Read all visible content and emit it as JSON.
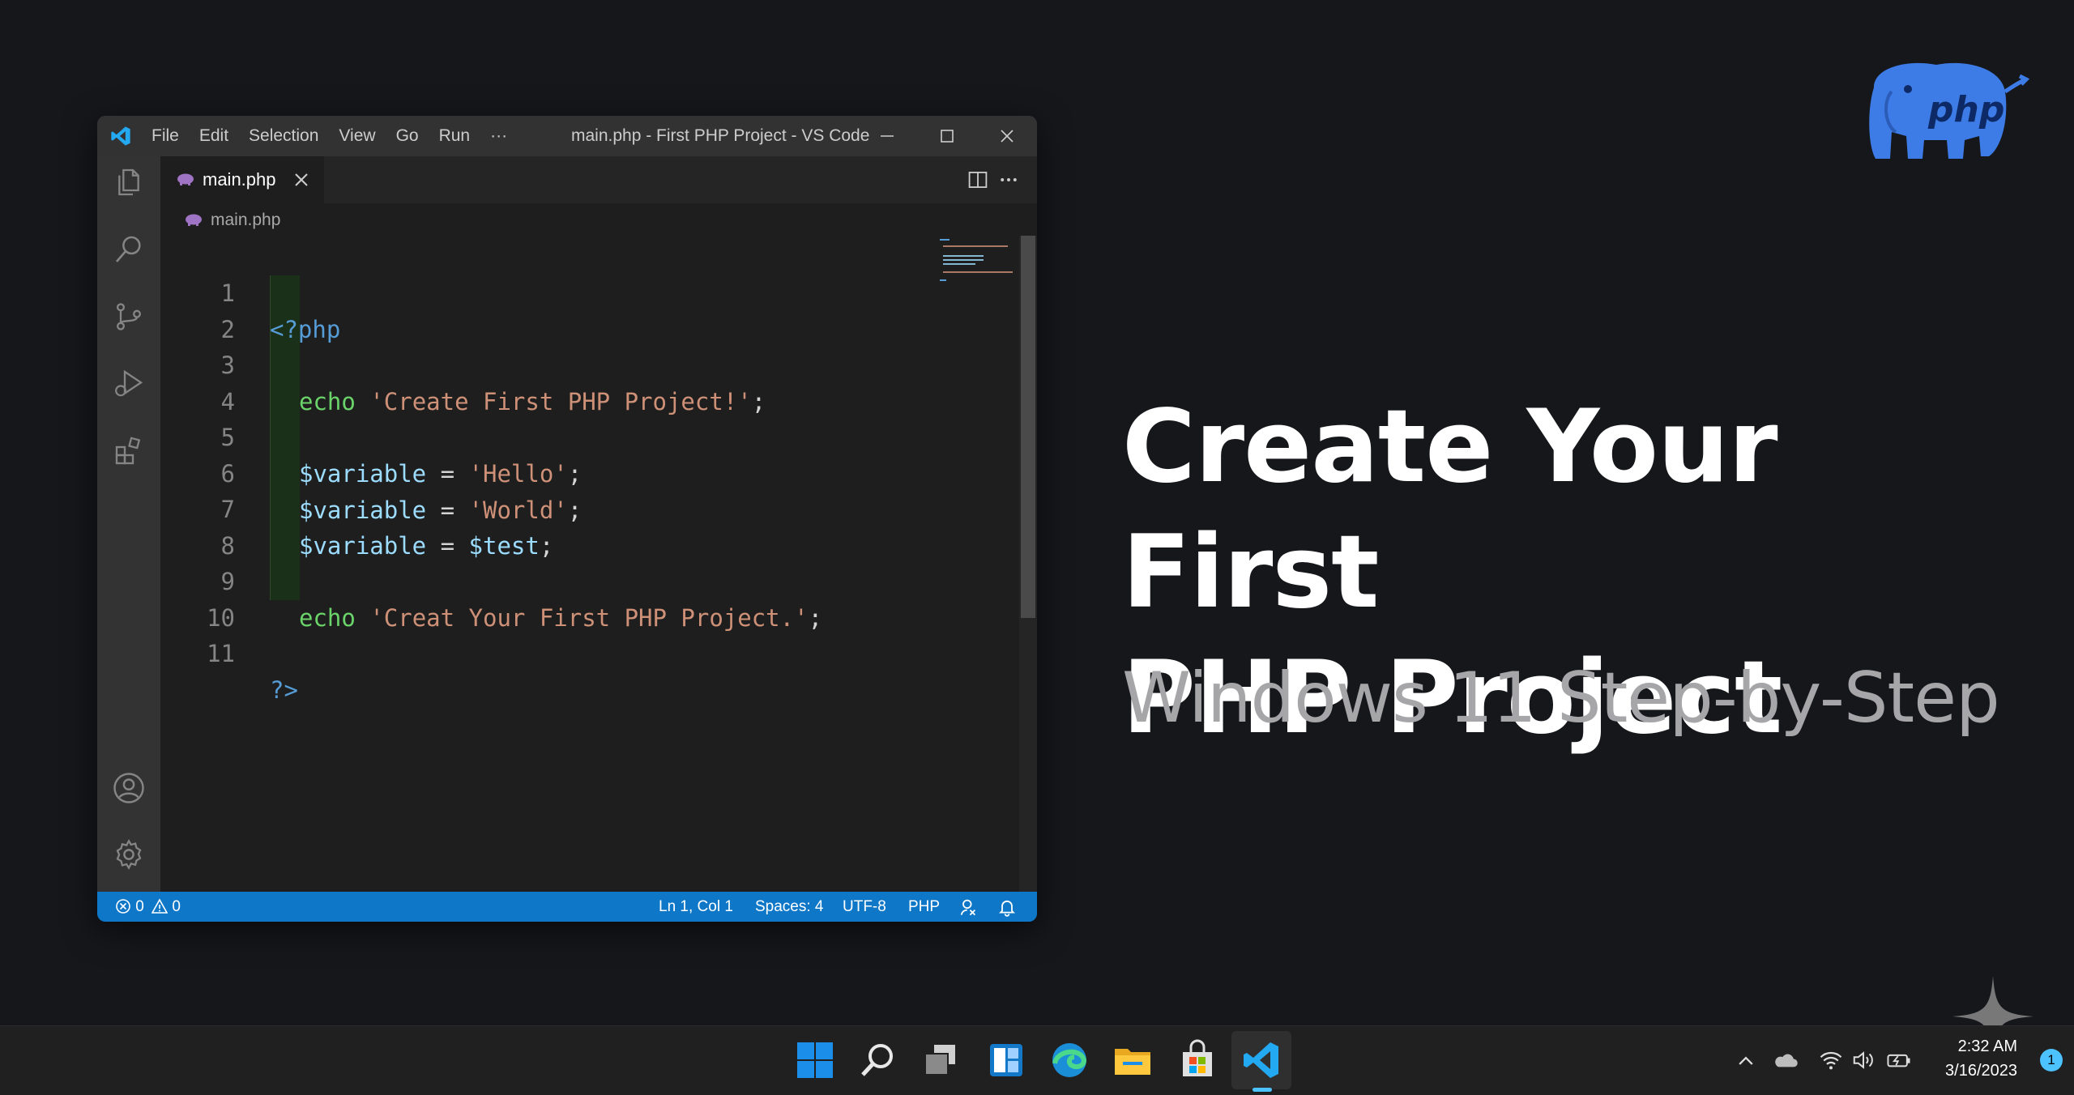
{
  "window": {
    "menu": [
      "File",
      "Edit",
      "Selection",
      "View",
      "Go",
      "Run",
      "···"
    ],
    "title": "main.php - First PHP Project - VS Code"
  },
  "tab": {
    "label": "main.php"
  },
  "breadcrumb": "main.php",
  "editor": {
    "lines": [
      {
        "n": "1"
      },
      {
        "n": "2"
      },
      {
        "n": "3"
      },
      {
        "n": "4"
      },
      {
        "n": "5"
      },
      {
        "n": "6"
      },
      {
        "n": "7"
      },
      {
        "n": "8"
      },
      {
        "n": "9"
      },
      {
        "n": "10"
      },
      {
        "n": "11"
      }
    ],
    "code": {
      "l1_open": "<?php",
      "l3_echo": "echo",
      "l3_str": "'Create First PHP Project!'",
      "l3_end": ";",
      "l5_var": "$variable",
      "l5_eq": " = ",
      "l5_str": "'Hello'",
      "l5_end": ";",
      "l6_var": "$variable",
      "l6_eq": " = ",
      "l6_str": "'World'",
      "l6_end": ";",
      "l7_var": "$variable",
      "l7_eq": " = ",
      "l7_val": "$test",
      "l7_end": ";",
      "l9_echo": "echo",
      "l9_str": "'Creat Your First PHP Project.'",
      "l9_end": ";",
      "l11_close": "?>"
    }
  },
  "statusbar": {
    "errors": "0",
    "warnings": "0",
    "position": "Ln 1, Col 1",
    "spaces": "Spaces: 4",
    "encoding": "UTF-8",
    "language": "PHP"
  },
  "headline": {
    "line1": "Create Your First",
    "line2": "PHP Project"
  },
  "subheadline": "Windows 11 Step-by-Step",
  "php_logo_text": "php",
  "taskbar": {
    "time": "2:32 AM",
    "date": "3/16/2023",
    "notifications": "1"
  },
  "colors": {
    "statusbar": "#0e77c8",
    "keyword_echo": "#6ad46a",
    "string": "#ce9178",
    "variable": "#9cdcfe",
    "tag": "#569cd6"
  }
}
